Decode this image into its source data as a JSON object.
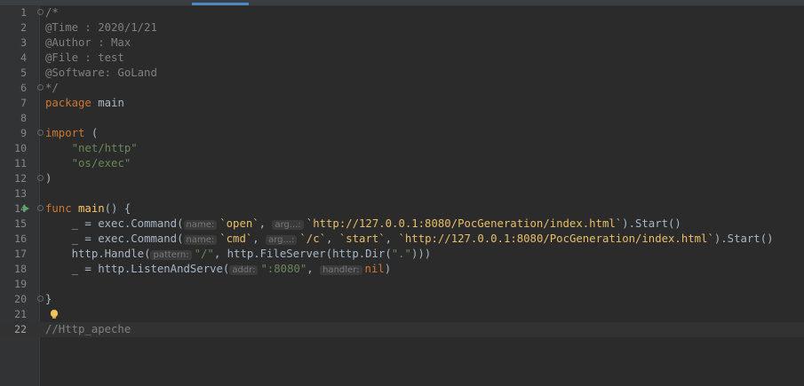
{
  "editor": {
    "lines": [
      {
        "n": "1",
        "text": "/*"
      },
      {
        "n": "2",
        "text": "@Time : 2020/1/21"
      },
      {
        "n": "3",
        "text": "@Author : Max"
      },
      {
        "n": "4",
        "text": "@File : test"
      },
      {
        "n": "5",
        "text": "@Software: GoLand"
      },
      {
        "n": "6",
        "text": "*/"
      },
      {
        "n": "7",
        "kw": "package",
        "rest": " main"
      },
      {
        "n": "8"
      },
      {
        "n": "9",
        "kw": "import",
        "rest": " ("
      },
      {
        "n": "10",
        "str": "\"net/http\""
      },
      {
        "n": "11",
        "str": "\"os/exec\""
      },
      {
        "n": "12",
        "rest": ")"
      },
      {
        "n": "13"
      },
      {
        "n": "14",
        "kw": "func",
        "fname": "main",
        "rest": "() {"
      },
      {
        "n": "15",
        "blank": "_",
        "assign": " = exec.",
        "method": "Command",
        "open": "(",
        "hint1": "name:",
        "arg1": "`open`",
        "sep": ", ",
        "hint2": "arg...:",
        "arg2": "`http://127.0.0.1:8080/PocGeneration/index.html`",
        "close": ").",
        "start": "Start",
        "end": "()"
      },
      {
        "n": "16",
        "blank": "_",
        "assign": " = exec.",
        "method": "Command",
        "open": "(",
        "hint1": "name:",
        "arg1": "`cmd`",
        "sep": ", ",
        "hint2": "arg...:",
        "arg2": "`/c`",
        "sep2": ", ",
        "arg3": "`start`",
        "sep3": ", ",
        "arg4": "`http://127.0.0.1:8080/PocGeneration/index.html`",
        "close": ").",
        "start": "Start",
        "end": "()"
      },
      {
        "n": "17",
        "pre": "http.",
        "method": "Handle",
        "open": "(",
        "hint1": "pattern:",
        "arg1": "\"/\"",
        "mid": ", http.",
        "method2": "FileServer",
        "mid2": "(http.",
        "type": "Dir",
        "mid3": "(",
        "arg2": "\".\"",
        "end": ")))"
      },
      {
        "n": "18",
        "blank": "_",
        "assign": " = http.",
        "method": "ListenAndServe",
        "open": "(",
        "hint1": "addr:",
        "arg1": "\":8080\"",
        "sep": ",",
        "hint2": "handler:",
        "kw": "nil",
        "end": ")"
      },
      {
        "n": "19"
      },
      {
        "n": "20",
        "rest": "}"
      },
      {
        "n": "21"
      },
      {
        "n": "22",
        "text": "//Http_apeche"
      }
    ]
  },
  "icons": {
    "fold": "fold-marker-icon",
    "run": "run-gutter-icon",
    "bulb": "intention-bulb-icon"
  },
  "colors": {
    "background": "#2b2b2b",
    "gutter": "#313335",
    "keyword": "#cc7832",
    "string": "#6a8759",
    "comment": "#808080",
    "function": "#ffc66d",
    "raw_string": "#e8bf6a",
    "run": "#59a869",
    "bulb": "#f2c55c"
  }
}
